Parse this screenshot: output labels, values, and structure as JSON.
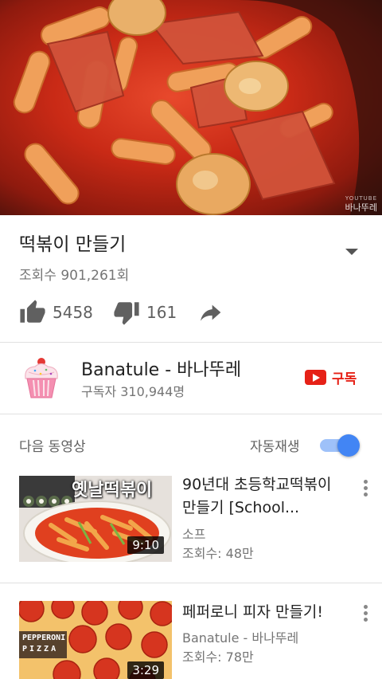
{
  "video": {
    "title": "떡볶이 만들기",
    "views": "조회수 901,261회",
    "watermark_youtube": "YOUTUBE",
    "watermark_channel": "바나뚜레"
  },
  "actions": {
    "likes": "5458",
    "dislikes": "161"
  },
  "channel": {
    "name": "Banatule - 바나뚜레",
    "subscribers": "구독자 310,944명",
    "subscribe_label": "구독",
    "accent_color": "#e62117"
  },
  "upnext": {
    "label": "다음 동영상",
    "autoplay_label": "자동재생",
    "autoplay_on": true
  },
  "recommendations": [
    {
      "title": "90년대 초등학교떡볶이 만들기 [School...",
      "channel": "소프",
      "views": "조회수: 48만",
      "duration": "9:10",
      "thumb_text": "옛날떡볶이"
    },
    {
      "title": "페퍼로니 피자 만들기!",
      "channel": "Banatule - 바나뚜레",
      "views": "조회수: 78만",
      "duration": "3:29",
      "thumb_text_1": "PEPPERONI",
      "thumb_text_2": "PIZZA"
    }
  ]
}
